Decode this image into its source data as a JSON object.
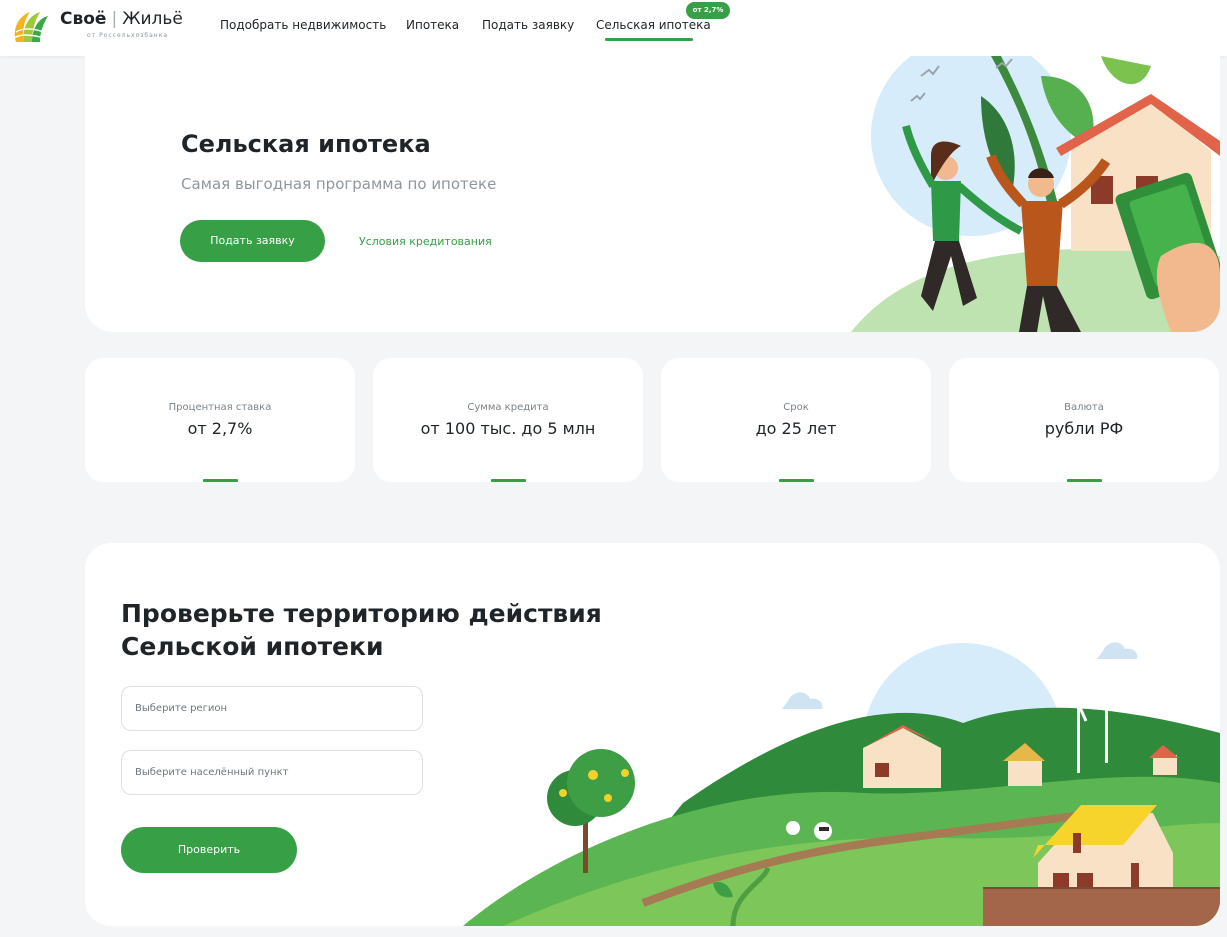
{
  "brand": {
    "name_bold": "Своё",
    "separator": "|",
    "name_thin": "Жильё",
    "tagline": "от Россельхозбанка"
  },
  "nav": {
    "items": [
      {
        "label": "Подобрать недвижимость",
        "active": false
      },
      {
        "label": "Ипотека",
        "active": false
      },
      {
        "label": "Подать заявку",
        "active": false
      },
      {
        "label": "Сельская ипотека",
        "active": true
      }
    ],
    "badge": "от 2,7%"
  },
  "hero": {
    "title": "Сельская ипотека",
    "subtitle": "Самая выгодная программа по ипотеке",
    "apply_button": "Подать заявку",
    "conditions_link": "Условия кредитования"
  },
  "stats": [
    {
      "label": "Процентная ставка",
      "value": "от 2,7%"
    },
    {
      "label": "Сумма кредита",
      "value": "от 100 тыс. до 5 млн"
    },
    {
      "label": "Срок",
      "value": "до 25 лет"
    },
    {
      "label": "Валюта",
      "value": "рубли РФ"
    }
  ],
  "territory": {
    "title_line1": "Проверьте территорию действия",
    "title_line2": "Сельской ипотеки",
    "region_placeholder": "Выберите регион",
    "city_placeholder": "Выберите населённый пункт",
    "check_button": "Проверить"
  },
  "colors": {
    "accent": "#37a047",
    "page_bg": "#f3f5f7",
    "card_bg": "#ffffff",
    "muted_text": "#8e979d"
  },
  "icons": [
    "logo-mark-icon"
  ]
}
